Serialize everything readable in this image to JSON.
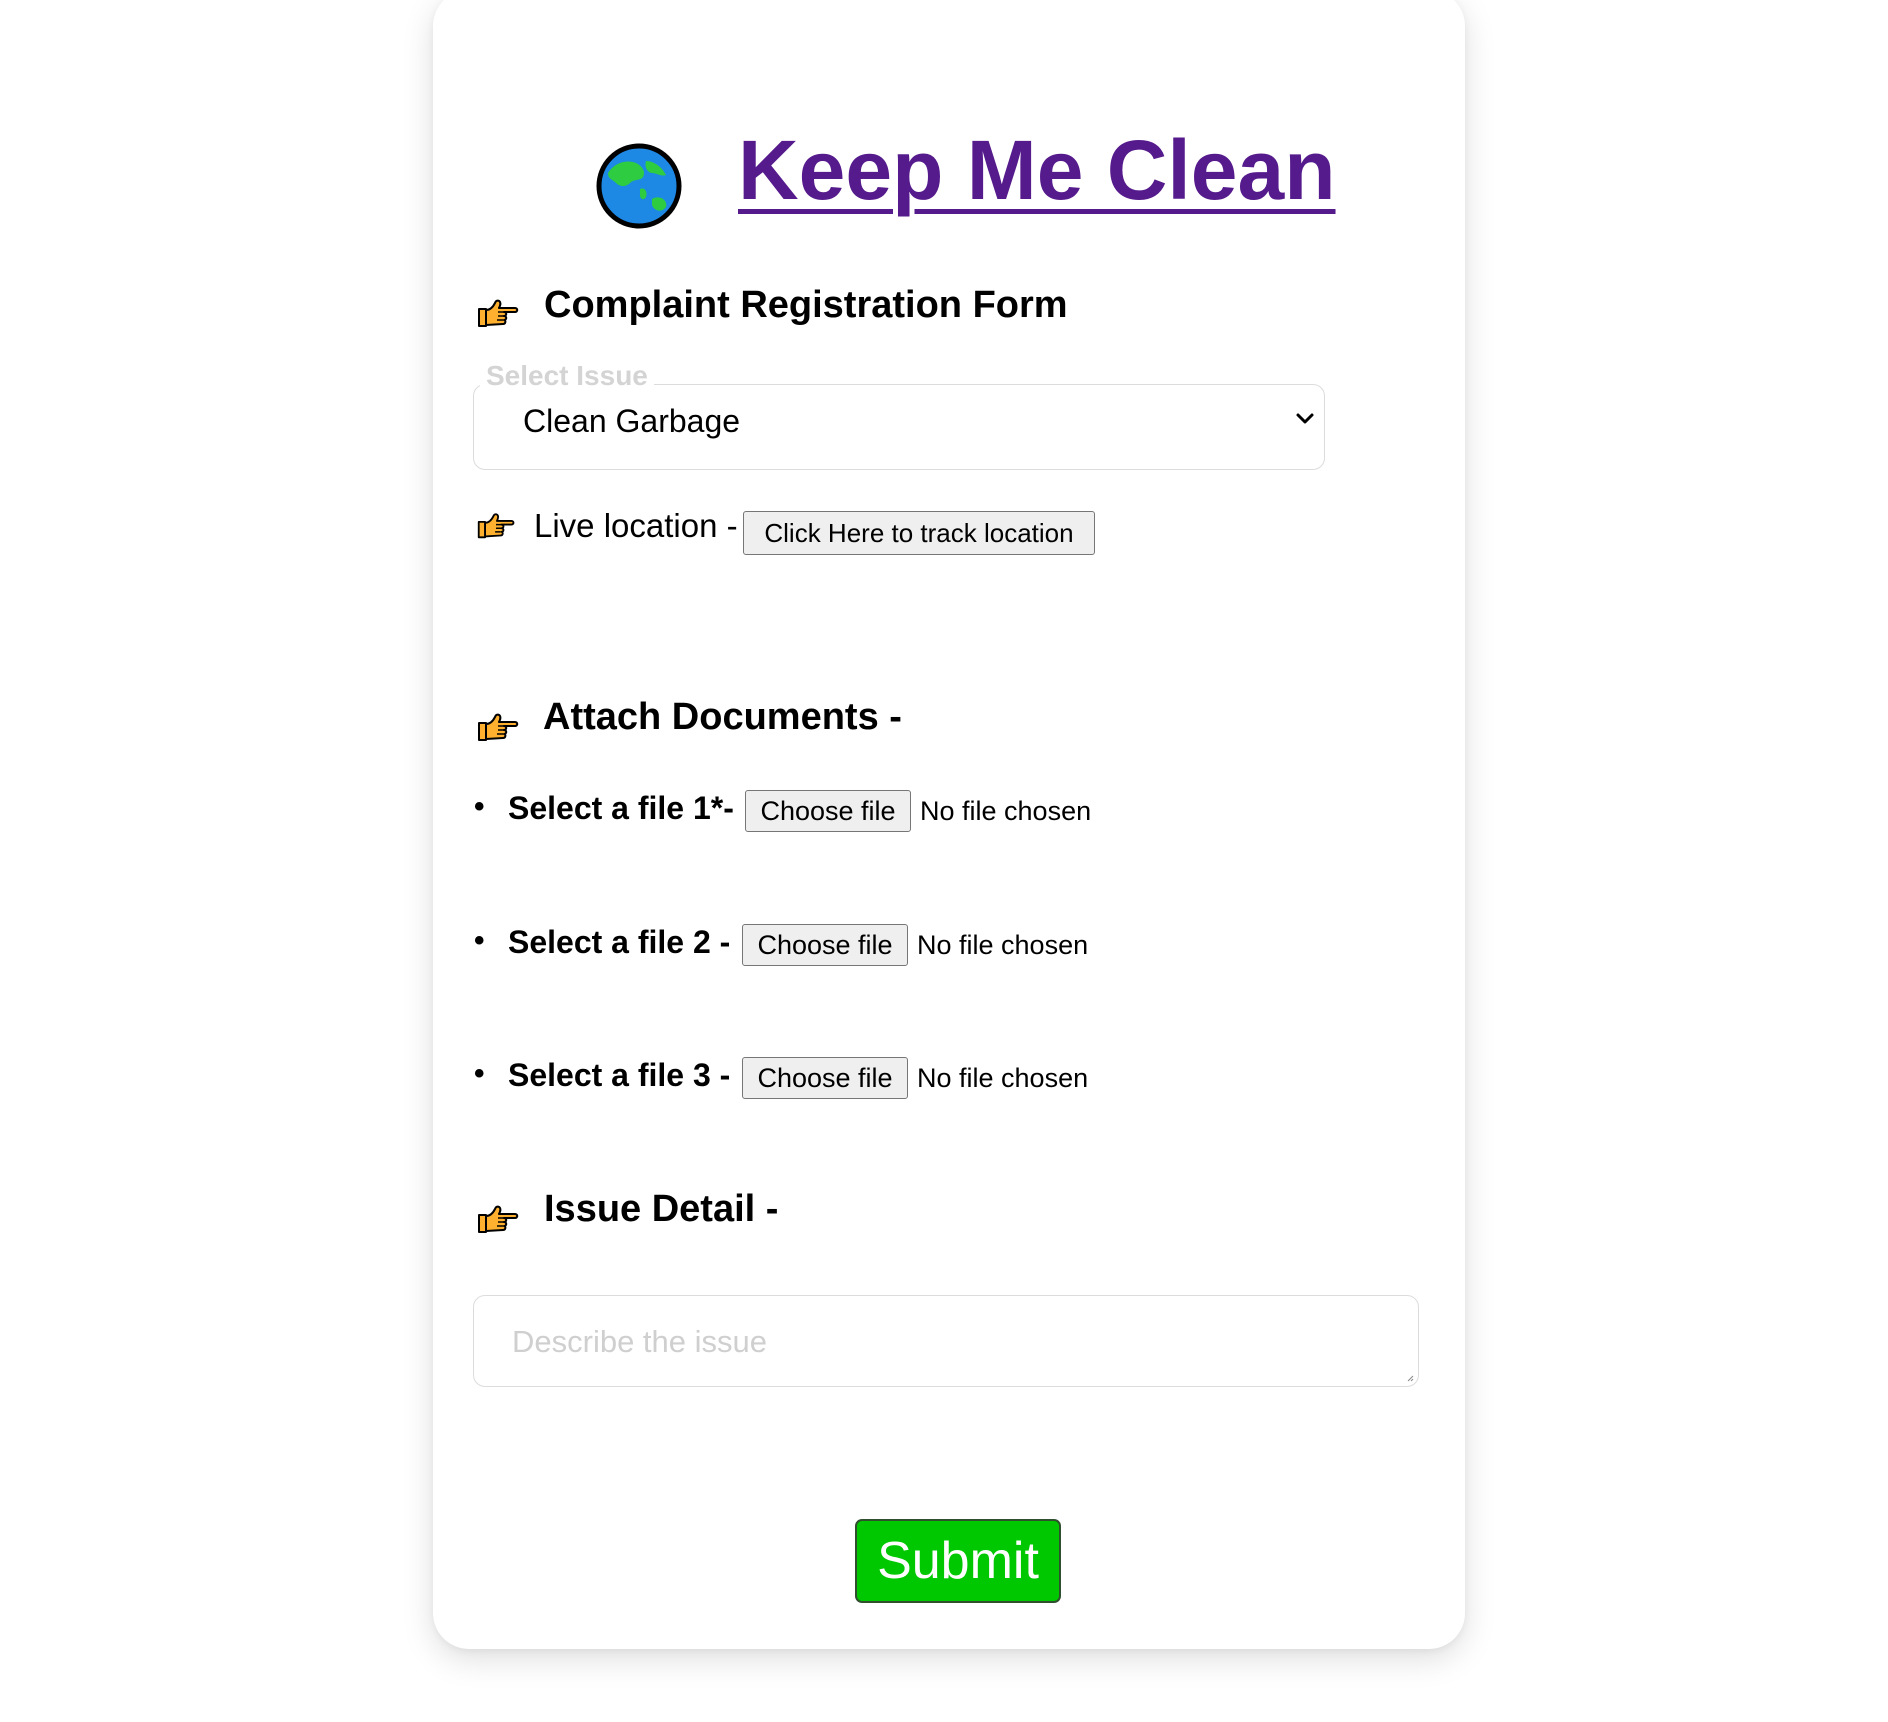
{
  "header": {
    "logo_icon": "globe-asia-icon",
    "title": "Keep Me Clean"
  },
  "form": {
    "heading": "Complaint Registration Form",
    "issue_select": {
      "legend": "Select Issue",
      "value": "Clean Garbage"
    },
    "live_location": {
      "label": "Live location -",
      "button_label": "Click Here to track location"
    },
    "attach": {
      "heading": "Attach Documents -",
      "files": [
        {
          "label": "Select a file 1*-",
          "button_label": "Choose file",
          "status": "No file chosen"
        },
        {
          "label": "Select a file 2 -",
          "button_label": "Choose file",
          "status": "No file chosen"
        },
        {
          "label": "Select a file 3 -",
          "button_label": "Choose file",
          "status": "No file chosen"
        }
      ]
    },
    "issue_detail": {
      "heading": "Issue Detail -",
      "placeholder": "Describe the issue"
    },
    "submit_label": "Submit"
  },
  "colors": {
    "title_link": "#551a8b",
    "submit_bg": "#00c800",
    "hand_fill": "#ffb02e",
    "globe_ocean": "#1e88e5",
    "globe_land": "#2ecc40"
  }
}
